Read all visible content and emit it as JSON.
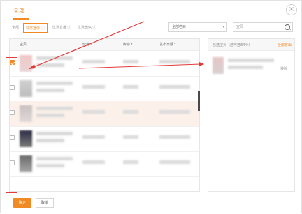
{
  "dialog": {
    "title": "全部",
    "close_icon": "×"
  },
  "filters": {
    "all": "全部",
    "chip1": "动态宣传 ⓘ",
    "chip2": "优选直播 ⓘ",
    "chip3": "优选微信 ⓘ"
  },
  "category_select": {
    "value": "全部栏目",
    "caret": "▾"
  },
  "search": {
    "placeholder": "宣贝"
  },
  "table": {
    "headers": [
      "宝贝",
      "价格↑",
      "库存↑",
      "发布日期↑"
    ],
    "rows": [
      {
        "checked": true,
        "highlight": false
      },
      {
        "checked": false,
        "highlight": false
      },
      {
        "checked": false,
        "highlight": true
      },
      {
        "checked": false,
        "highlight": false
      },
      {
        "checked": false,
        "highlight": false
      }
    ]
  },
  "selected_panel": {
    "title": "已选宝贝（还可选84个）",
    "clear_label": "全部移出",
    "remove_label": "移除"
  },
  "footer": {
    "ok_label": "确定",
    "cancel_label": "取消"
  },
  "colors": {
    "accent": "#f08a24",
    "annotation_red": "#e23b3b",
    "row_highlight": "#fcf1ea"
  }
}
